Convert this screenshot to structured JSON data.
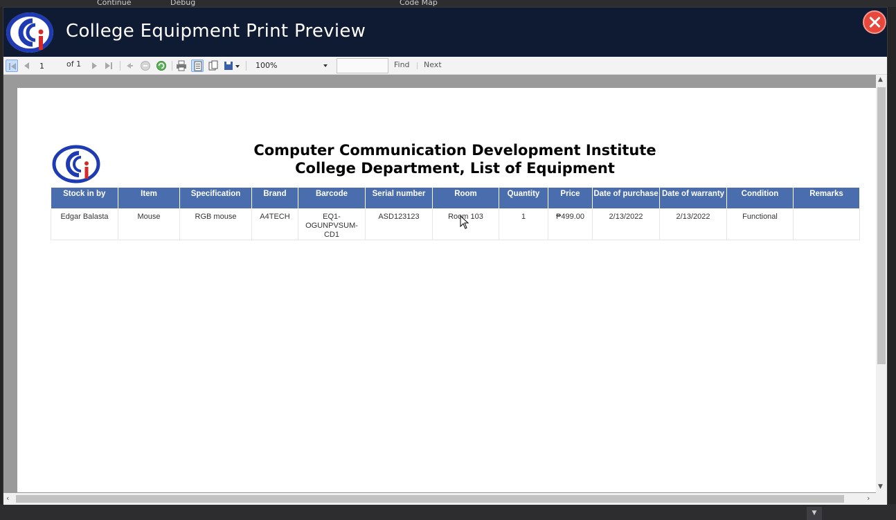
{
  "ide": {
    "menu_continue": "Continue",
    "menu_debug": "Debug",
    "menu_codemap": "Code Map"
  },
  "window": {
    "title": "College Equipment Print Preview"
  },
  "toolbar": {
    "current_page": "1",
    "of_pages": "of 1",
    "zoom": "100%",
    "find_label": "Find",
    "next_label": "Next",
    "find_value": ""
  },
  "report": {
    "title_line1": "Computer Communication Development Institute",
    "title_line2": "College Department, List of Equipment",
    "columns": [
      "Stock in by",
      "Item",
      "Specification",
      "Brand",
      "Barcode",
      "Serial number",
      "Room",
      "Quantity",
      "Price",
      "Date of purchase",
      "Date of warranty",
      "Condition",
      "Remarks"
    ],
    "rows": [
      [
        "Edgar Balasta",
        "Mouse",
        "RGB mouse",
        "A4TECH",
        "EQ1-OGUNPVSUM-CD1",
        "ASD123123",
        "Room 103",
        "1",
        "₱499.00",
        "2/13/2022",
        "2/13/2022",
        "Functional",
        ""
      ]
    ]
  },
  "colors": {
    "titlebar_bg": "#0f1a33",
    "header_bg": "#4a6ead",
    "close_red": "#e7483b",
    "logo_blue": "#1f3bb3",
    "logo_red": "#d42a2a"
  }
}
